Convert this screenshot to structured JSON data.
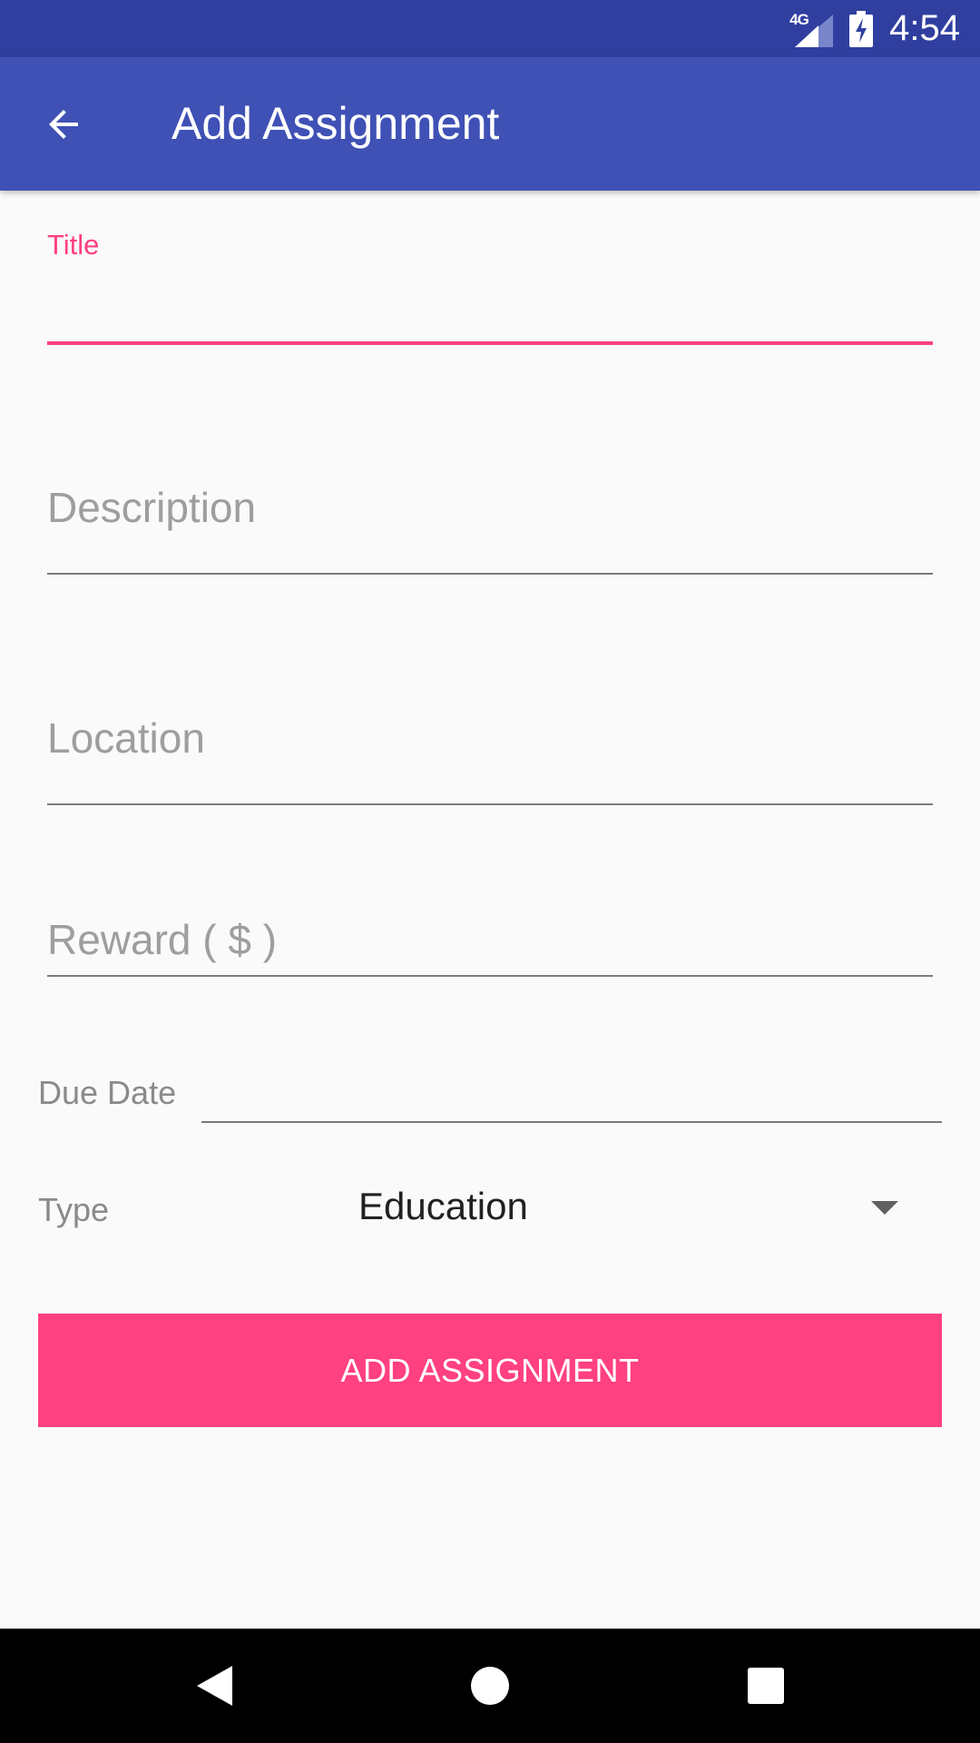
{
  "status_bar": {
    "network_label": "4G",
    "time": "4:54"
  },
  "app_bar": {
    "back_icon": "arrow-back-icon",
    "title": "Add Assignment"
  },
  "form": {
    "title": {
      "label": "Title",
      "value": ""
    },
    "description": {
      "placeholder": "Description",
      "value": ""
    },
    "location": {
      "placeholder": "Location",
      "value": ""
    },
    "reward": {
      "placeholder": "Reward ( $ )",
      "value": ""
    },
    "due_date": {
      "label": "Due Date",
      "value": ""
    },
    "type": {
      "label": "Type",
      "selected": "Education"
    },
    "submit_label": "ADD ASSIGNMENT"
  },
  "nav_bar": {
    "back_icon": "triangle-back-icon",
    "home_icon": "circle-home-icon",
    "recents_icon": "square-recents-icon"
  },
  "colors": {
    "status_bar": "#303F9F",
    "primary": "#3F51B5",
    "accent": "#FF4081",
    "background": "#FAFAFA"
  }
}
